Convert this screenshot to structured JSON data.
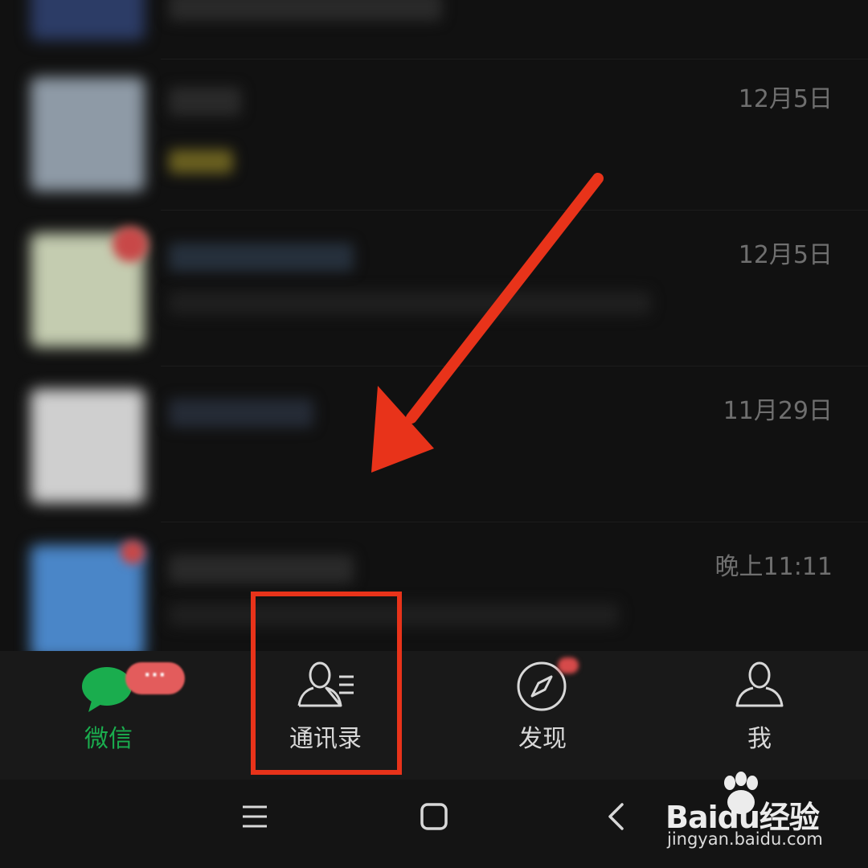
{
  "chat_list": {
    "rows": [
      {
        "time": ""
      },
      {
        "time": "12月5日"
      },
      {
        "time": "12月5日"
      },
      {
        "time": "11月29日"
      },
      {
        "time": "晚上11:11"
      }
    ]
  },
  "tab_bar": {
    "tabs": [
      {
        "label": "微信",
        "active": true,
        "badge": "···"
      },
      {
        "label": "通讯录",
        "active": false
      },
      {
        "label": "发现",
        "active": false
      },
      {
        "label": "我",
        "active": false
      }
    ],
    "active_color": "#1aad4e"
  },
  "annotation": {
    "color": "#e8331a"
  },
  "watermark": {
    "brand": "Baidu经验",
    "url": "jingyan.baidu.com"
  }
}
